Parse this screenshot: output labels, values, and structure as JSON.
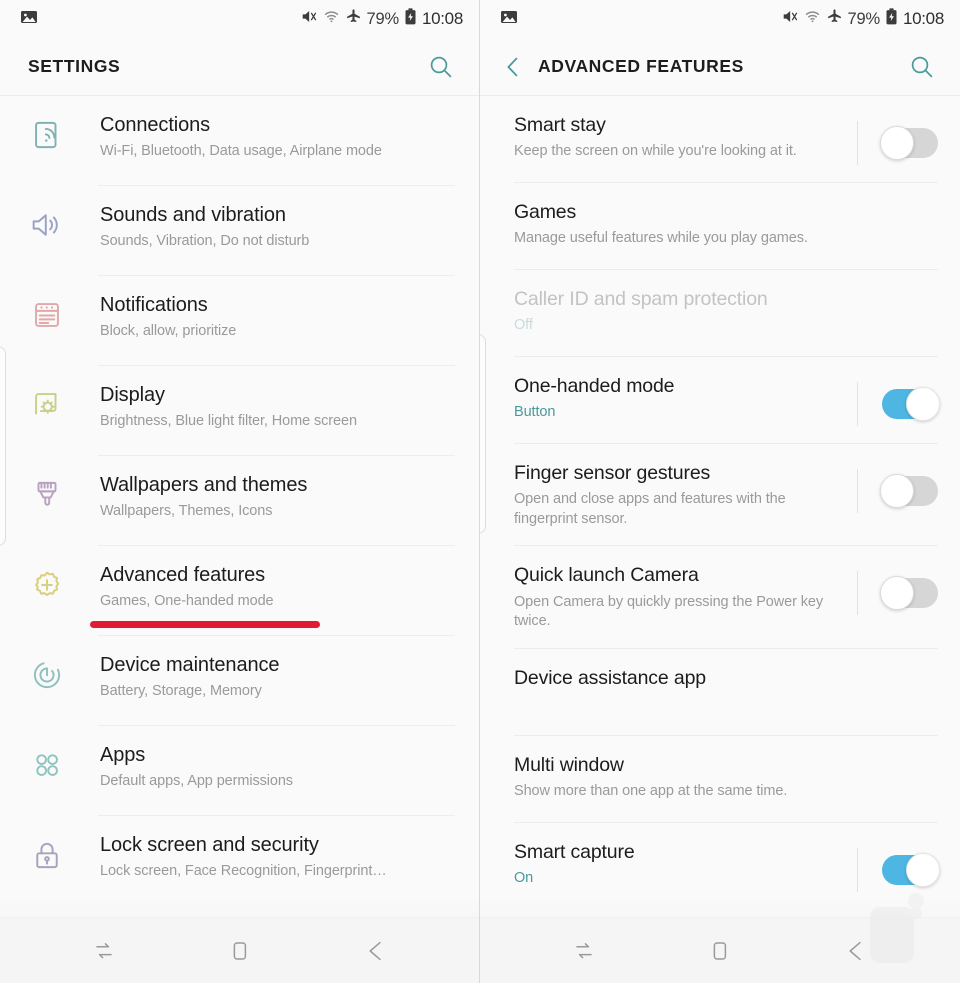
{
  "status_bar": {
    "notification_icon": "image-icon",
    "mute_icon": "mute-icon",
    "wifi_icon": "wifi-icon",
    "airplane_icon": "airplane-mode-icon",
    "battery_percent": "79%",
    "battery_icon": "battery-icon",
    "time": "10:08"
  },
  "colors": {
    "accent_teal": "#4a9a9c",
    "toggle_on": "#4db6e2",
    "toggle_off": "#d6d6d6",
    "annotation_red": "#e01b33",
    "title_text": "#1c1c1c",
    "subtitle_text": "#9a9a9a"
  },
  "left_panel": {
    "title": "SETTINGS",
    "search_label": "Search",
    "items": [
      {
        "title": "Connections",
        "subtitle": "Wi-Fi, Bluetooth, Data usage, Airplane mode",
        "icon": "connections-icon",
        "icon_color": "#7fb3b3"
      },
      {
        "title": "Sounds and vibration",
        "subtitle": "Sounds, Vibration, Do not disturb",
        "icon": "speaker-icon",
        "icon_color": "#9aa2c4"
      },
      {
        "title": "Notifications",
        "subtitle": "Block, allow, prioritize",
        "icon": "notifications-icon",
        "icon_color": "#e0a8a8"
      },
      {
        "title": "Display",
        "subtitle": "Brightness, Blue light filter, Home screen",
        "icon": "display-brightness-icon",
        "icon_color": "#c9d08a"
      },
      {
        "title": "Wallpapers and themes",
        "subtitle": "Wallpapers, Themes, Icons",
        "icon": "paintbrush-icon",
        "icon_color": "#b9a2c0"
      },
      {
        "title": "Advanced features",
        "subtitle": "Games, One-handed mode",
        "icon": "gear-plus-icon",
        "icon_color": "#d8cf7a"
      },
      {
        "title": "Device maintenance",
        "subtitle": "Battery, Storage, Memory",
        "icon": "refresh-circle-icon",
        "icon_color": "#8fc0bd"
      },
      {
        "title": "Apps",
        "subtitle": "Default apps, App permissions",
        "icon": "apps-grid-icon",
        "icon_color": "#8fc4c0"
      },
      {
        "title": "Lock screen and security",
        "subtitle": "Lock screen, Face Recognition, Fingerprint…",
        "icon": "lock-icon",
        "icon_color": "#a8a2bd"
      }
    ]
  },
  "right_panel": {
    "title": "ADVANCED FEATURES",
    "back_label": "Back",
    "search_label": "Search",
    "items": [
      {
        "title": "Smart stay",
        "subtitle": "Keep the screen on while you're looking at it.",
        "has_toggle": true,
        "toggle_on": false,
        "disabled": false,
        "status_style": false
      },
      {
        "title": "Games",
        "subtitle": "Manage useful features while you play games.",
        "has_toggle": false,
        "toggle_on": false,
        "disabled": false,
        "status_style": false
      },
      {
        "title": "Caller ID and spam protection",
        "subtitle": "Off",
        "has_toggle": false,
        "toggle_on": false,
        "disabled": true,
        "status_style": true
      },
      {
        "title": "One-handed mode",
        "subtitle": "Button",
        "has_toggle": true,
        "toggle_on": true,
        "disabled": false,
        "status_style": true
      },
      {
        "title": "Finger sensor gestures",
        "subtitle": "Open and close apps and features with the fingerprint sensor.",
        "has_toggle": true,
        "toggle_on": false,
        "disabled": false,
        "status_style": false
      },
      {
        "title": "Quick launch Camera",
        "subtitle": "Open Camera by quickly pressing the Power key twice.",
        "has_toggle": true,
        "toggle_on": false,
        "disabled": false,
        "status_style": false
      },
      {
        "title": "Device assistance app",
        "subtitle": "",
        "has_toggle": false,
        "toggle_on": false,
        "disabled": false,
        "status_style": false
      },
      {
        "title": "Multi window",
        "subtitle": "Show more than one app at the same time.",
        "has_toggle": false,
        "toggle_on": false,
        "disabled": false,
        "status_style": false
      },
      {
        "title": "Smart capture",
        "subtitle": "On",
        "has_toggle": true,
        "toggle_on": true,
        "disabled": false,
        "status_style": true
      }
    ]
  },
  "nav_bar": {
    "recents_label": "Recents",
    "home_label": "Home",
    "back_label": "Back"
  },
  "annotations": {
    "left_underline_target": "Advanced features",
    "right_underline_target": "One-handed mode"
  }
}
